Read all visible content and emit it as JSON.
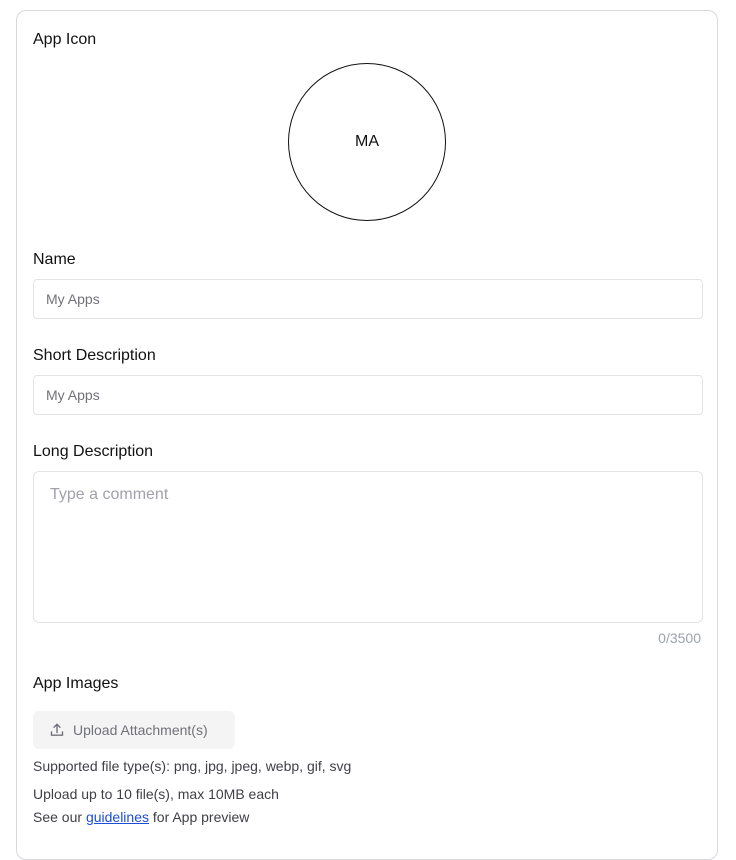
{
  "app_icon": {
    "label": "App Icon",
    "initials": "MA"
  },
  "name": {
    "label": "Name",
    "placeholder": "My Apps"
  },
  "short_description": {
    "label": "Short Description",
    "placeholder": "My Apps"
  },
  "long_description": {
    "label": "Long Description",
    "placeholder": "Type a comment",
    "counter": "0/3500"
  },
  "app_images": {
    "label": "App Images",
    "upload_button": "Upload Attachment(s)",
    "upload_icon": "upload-icon",
    "supported_types": "Supported file type(s): png, jpg, jpeg, webp, gif, svg",
    "limits": "Upload up to 10 file(s), max 10MB each",
    "guidelines_prefix": "See our",
    "guidelines_link": "guidelines",
    "guidelines_suffix": "for App preview"
  },
  "colors": {
    "link": "#1d4ed8",
    "border": "#e4e4e7",
    "button_bg": "#f4f4f5"
  }
}
